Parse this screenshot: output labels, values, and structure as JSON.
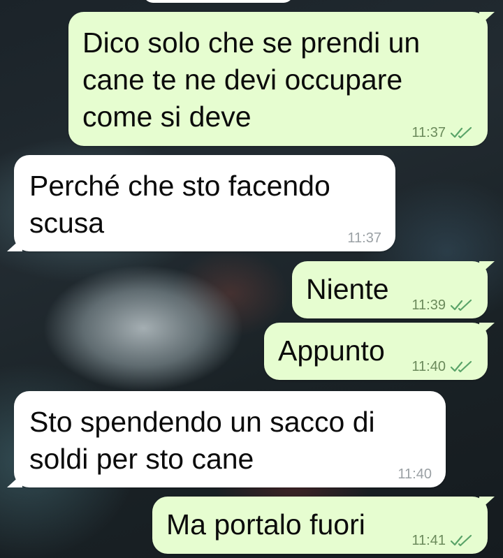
{
  "colors": {
    "outgoing_bubble": "#e6fdd0",
    "incoming_bubble": "#ffffff",
    "read_ticks": "#5aa469"
  },
  "messages": [
    {
      "direction": "outgoing",
      "text": "Dico solo che se prendi un\ncane te ne devi occupare\ncome si deve",
      "time": "11:37",
      "status_icon": "double-check-icon"
    },
    {
      "direction": "incoming",
      "text": "Perché che sto facendo\nscusa",
      "time": "11:37"
    },
    {
      "direction": "outgoing",
      "text": "Niente",
      "time": "11:39",
      "status_icon": "double-check-icon"
    },
    {
      "direction": "outgoing",
      "text": "Appunto",
      "time": "11:40",
      "status_icon": "double-check-icon"
    },
    {
      "direction": "incoming",
      "text": "Sto spendendo un sacco di\nsoldi per sto cane",
      "time": "11:40"
    },
    {
      "direction": "outgoing",
      "text": "Ma portalo fuori",
      "time": "11:41",
      "status_icon": "double-check-icon"
    }
  ]
}
